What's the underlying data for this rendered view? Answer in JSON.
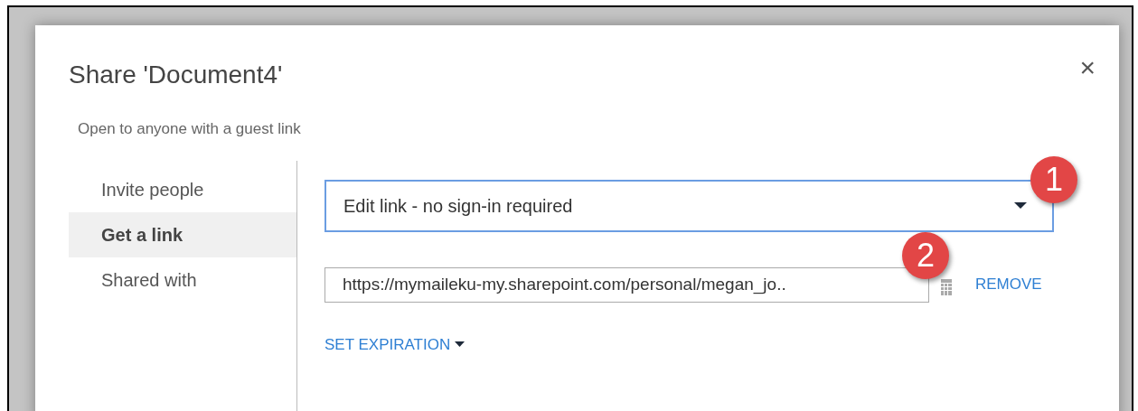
{
  "dialog": {
    "title": "Share 'Document4'",
    "subtitle": "Open to anyone with a guest link",
    "close": "×"
  },
  "nav": [
    {
      "label": "Invite people",
      "selected": false
    },
    {
      "label": "Get a link",
      "selected": true
    },
    {
      "label": "Shared with",
      "selected": false
    }
  ],
  "link_type_dropdown": {
    "value": "Edit link - no sign-in required"
  },
  "link_field": {
    "value": "https://mymaileku-my.sharepoint.com/personal/megan_jo.."
  },
  "remove_link": "REMOVE",
  "set_expiration": "SET EXPIRATION",
  "callouts": [
    "1",
    "2"
  ]
}
